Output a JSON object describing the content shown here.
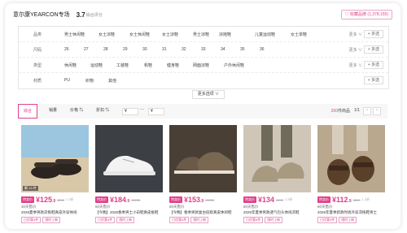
{
  "header": {
    "store_name": "意尔康YEARCON专场",
    "rating": "3.7",
    "rating_label": "综合评分",
    "favorite": "♡ 收藏品牌 (1,378,155)"
  },
  "filters": [
    {
      "label": "品类",
      "options": [
        "男士休闲鞋",
        "女士凉鞋",
        "女士休闲鞋",
        "女士凉鞋",
        "男士凉鞋",
        "凉拖鞋",
        "儿童运动鞋",
        "女士单鞋"
      ],
      "more": "更多 ∨",
      "multi": "+ 多选"
    },
    {
      "label": "尺码",
      "options": [
        "26",
        "27",
        "28",
        "29",
        "30",
        "31",
        "32",
        "33",
        "34",
        "35",
        "36"
      ],
      "more": "更多 ∨",
      "multi": "+ 多选"
    },
    {
      "label": "类型",
      "options": [
        "休闲鞋",
        "运动鞋",
        "工装鞋",
        "帆鞋",
        "健身鞋",
        "网面凉鞋",
        "户外休闲鞋"
      ],
      "more": "更多 ∨",
      "multi": "+ 多选"
    },
    {
      "label": "材质",
      "options": [
        "PU",
        "织物",
        "其他"
      ],
      "more": "",
      "multi": "+ 多选"
    }
  ],
  "more_filter": "更多选项 ∨",
  "sortbar": {
    "tabs": [
      "综合",
      "销量",
      "价格 ⇅",
      "折扣 ⇅"
    ],
    "price_from": "¥",
    "price_dash": "—",
    "price_to": "¥",
    "count_num": "200",
    "count_text": "件商品",
    "pager": "1/1",
    "prev": "‹",
    "next": "›"
  },
  "products": [
    {
      "badge": "剩 13 件",
      "tag": "特卖价",
      "price_int": "¥125",
      "price_dec": ".9",
      "orig": "¥899",
      "discount": "1.4折",
      "sales": "30天售价",
      "title": "2025夏季男款凉拖鞋真皮外穿休闲",
      "pills": [
        "已优惠4件",
        "限时上新"
      ]
    },
    {
      "badge": "",
      "tag": "特卖价",
      "price_int": "¥184",
      "price_dec": ".9",
      "orig": "¥1239",
      "discount": "",
      "sales": "60天售价",
      "title": "【今晚】2025春季男士小白鞋真皮板鞋",
      "pills": [
        "已优惠4件",
        "限时上新"
      ]
    },
    {
      "badge": "",
      "tag": "特卖价",
      "price_int": "¥153",
      "price_dec": ".9",
      "orig": "¥1259",
      "discount": "",
      "sales": "60天售价",
      "title": "【今晚】春季男款复古低帮真皮休闲鞋",
      "pills": [
        "已优惠4件",
        "限时上新"
      ]
    },
    {
      "badge": "",
      "tag": "特卖价",
      "price_int": "¥134",
      "price_dec": "",
      "orig": "¥899",
      "discount": "1.3折",
      "sales": "60天售价",
      "title": "2025年夏季男款透气包头休闲凉鞋",
      "pills": [
        "已优惠4件",
        "限时上新"
      ]
    },
    {
      "badge": "",
      "tag": "特卖价",
      "price_int": "¥112",
      "price_dec": ".9",
      "orig": "¥899",
      "discount": "1.3折",
      "sales": "60天售价",
      "title": "2025年夏季新款时尚外穿凉拖鞋男士",
      "pills": [
        "已优惠4件",
        "限时上新"
      ]
    }
  ],
  "colors": {
    "accent": "#e0408a"
  }
}
